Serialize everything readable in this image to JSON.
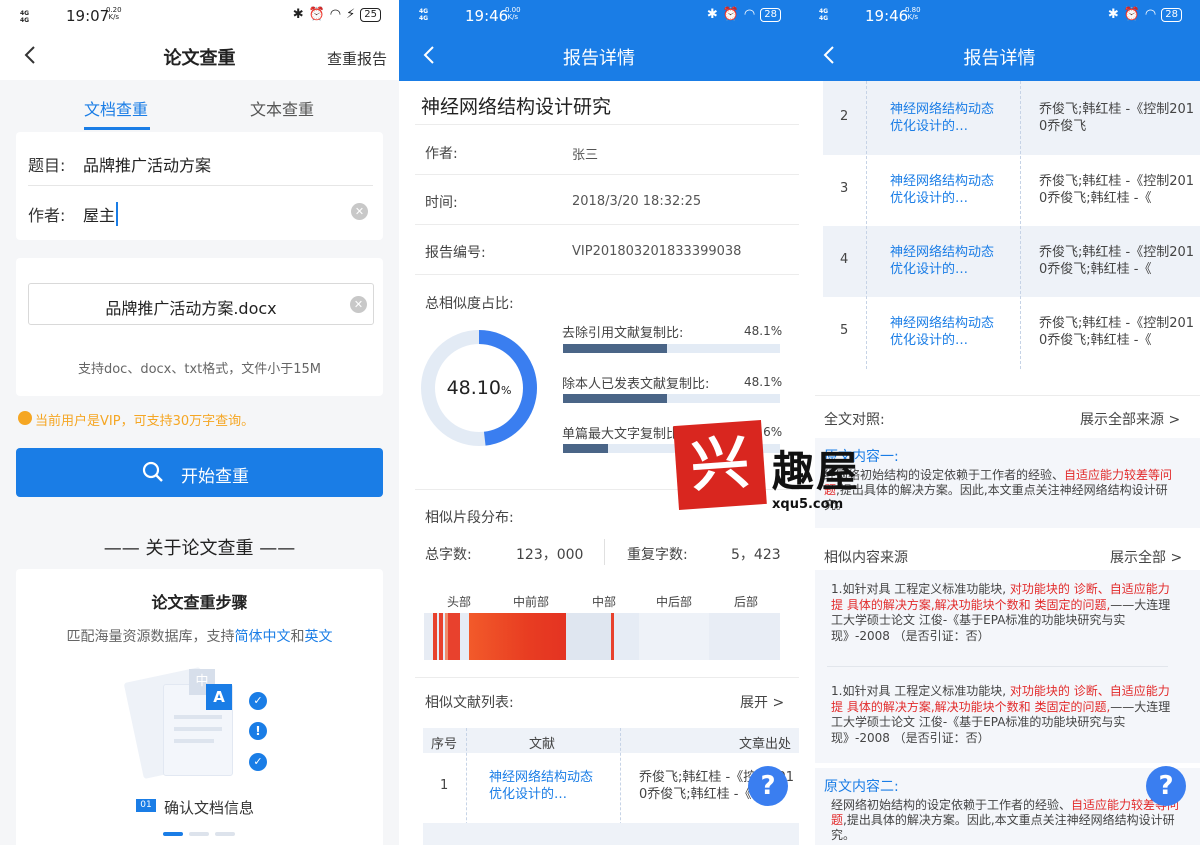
{
  "brand_colors": {
    "accent": "#1a7de6",
    "red": "#e22b2b",
    "orange": "#f5a623",
    "page_bg": "#f5f6f8"
  },
  "screen1": {
    "status": {
      "net": "4G",
      "time": "19:07",
      "rate_value": "0.20",
      "rate_unit": "K/s",
      "battery": "25"
    },
    "nav": {
      "title": "论文查重",
      "action": "查重报告"
    },
    "tabs": [
      "文档查重",
      "文本查重"
    ],
    "form": {
      "title_label": "题目:",
      "title_value": "品牌推广活动方案",
      "author_label": "作者:",
      "author_value": "屋主"
    },
    "upload": {
      "file_name": "品牌推广活动方案.docx",
      "hint": "支持doc、docx、txt格式，文件小于15M"
    },
    "vip_notice": "当前用户是VIP，可支持30万字查询。",
    "start_button": "开始查重",
    "about_title": "—— 关于论文查重 ——",
    "steps": {
      "title": "论文查重步骤",
      "desc_prefix": "匹配海量资源数据库，支持",
      "desc_hl1": "简体中文",
      "desc_mid": "和",
      "desc_hl2": "英文",
      "illus_char": "中",
      "illus_letter": "A",
      "step_num": "01",
      "step_label": "确认文档信息"
    }
  },
  "screen2": {
    "status": {
      "net": "4G",
      "time": "19:46",
      "rate_value": "0.00",
      "rate_unit": "K/s",
      "battery": "28"
    },
    "nav": {
      "title": "报告详情"
    },
    "paper_title": "神经网络结构设计研究",
    "meta": [
      {
        "label": "作者:",
        "value": "张三"
      },
      {
        "label": "时间:",
        "value": "2018/3/20 18:32:25"
      },
      {
        "label": "报告编号:",
        "value": "VIP201803201833399038"
      }
    ],
    "similarity": {
      "label": "总相似度占比:",
      "total_display": "48.10",
      "total_unit": "%",
      "total_fraction": 0.481,
      "bars": [
        {
          "label": "去除引用文献复制比:",
          "value": "48.1%",
          "fraction": 0.481
        },
        {
          "label": "除本人已发表文献复制比:",
          "value": "48.1%",
          "fraction": 0.481
        },
        {
          "label": "单篇最大文字复制比:",
          "value": "20.6%",
          "fraction": 0.206
        }
      ]
    },
    "distribution": {
      "label": "相似片段分布:",
      "total_chars_label": "总字数:",
      "total_chars": "123，000",
      "repeat_chars_label": "重复字数:",
      "repeat_chars": "5，423",
      "segments": [
        "头部",
        "中前部",
        "中部",
        "中后部",
        "后部"
      ]
    },
    "lit_list": {
      "label": "相似文献列表:",
      "expand": "展开 >",
      "headers": [
        "序号",
        "文献",
        "文章出处"
      ],
      "rows": [
        {
          "no": "1",
          "title": "神经网络结构动态优化设计的…",
          "source": "乔俊飞;韩红桂 -《控制2010乔俊飞;韩红桂 -《"
        }
      ]
    },
    "help": "?"
  },
  "screen3": {
    "status": {
      "net": "4G",
      "time": "19:46",
      "rate_value": "0.80",
      "rate_unit": "K/s",
      "battery": "28"
    },
    "nav": {
      "title": "报告详情"
    },
    "rows": [
      {
        "no": "2",
        "title": "神经网络结构动态优化设计的…",
        "source": "乔俊飞;韩红桂 -《控制2010乔俊飞"
      },
      {
        "no": "3",
        "title": "神经网络结构动态优化设计的…",
        "source": "乔俊飞;韩红桂 -《控制2010乔俊飞;韩红桂 -《"
      },
      {
        "no": "4",
        "title": "神经网络结构动态优化设计的…",
        "source": "乔俊飞;韩红桂 -《控制2010乔俊飞;韩红桂 -《"
      },
      {
        "no": "5",
        "title": "神经网络结构动态优化设计的…",
        "source": "乔俊飞;韩红桂 -《控制2010乔俊飞;韩红桂 -《"
      }
    ],
    "compare": {
      "label": "全文对照:",
      "action": "展示全部来源 >"
    },
    "original1": {
      "title": "原文内容一:",
      "text_a": "经网络初始结构的设定依赖于工作者的经验、",
      "text_red": "自适应能力较差等问题",
      "text_b": ",提出具体的解决方案。因此,本文重点关注神经网络结构设计研究。"
    },
    "sources": {
      "label": "相似内容来源",
      "action": "展示全部 >",
      "items": [
        {
          "a": "1.如针对具 工程定义标准功能块, ",
          "red": "对功能块的 诊断、自适应能力提 具体的解决方案,解决功能块个数和 类固定的问题,",
          "b": "——大连理工大学硕士论文 江俊-《基于EPA标准的功能块研究与实现》-2008 （是否引证：否）"
        },
        {
          "a": "1.如针对具 工程定义标准功能块, ",
          "red": "对功能块的 诊断、自适应能力提 具体的解决方案,解决功能块个数和 类固定的问题,",
          "b": "——大连理工大学硕士论文 江俊-《基于EPA标准的功能块研究与实现》-2008 （是否引证：否）"
        }
      ]
    },
    "original2": {
      "title": "原文内容二:",
      "text_a": "经网络初始结构的设定依赖于工作者的经验、",
      "text_red": "自适应能力较差等问题",
      "text_b": ",提出具体的解决方案。因此,本文重点关注神经网络结构设计研究。"
    },
    "help": "?"
  },
  "watermark": {
    "char": "兴",
    "name": "趣屋",
    "domain": "xqu5.com"
  }
}
